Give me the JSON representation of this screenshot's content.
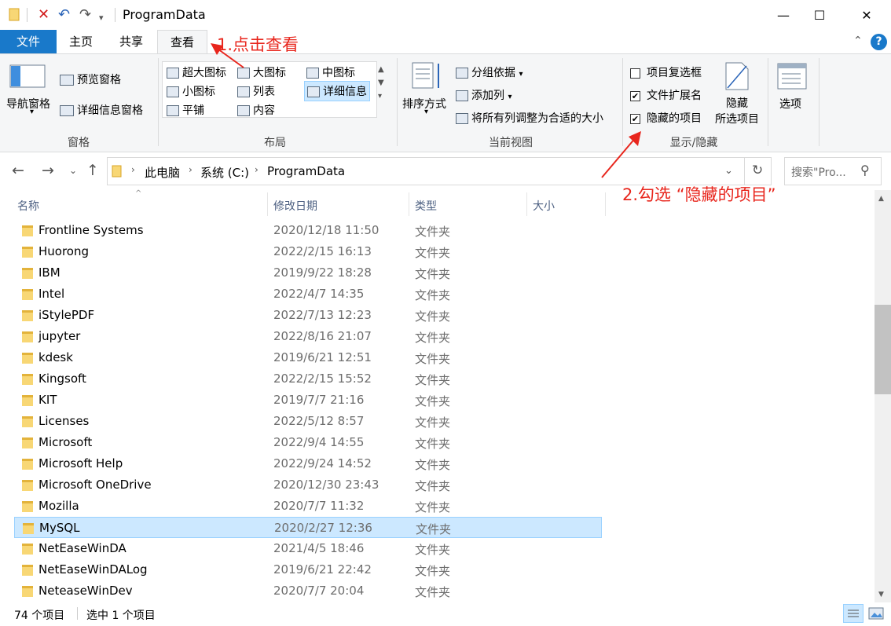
{
  "window": {
    "title": "ProgramData",
    "minimize_glyph": "—",
    "maximize_glyph": "☐",
    "close_glyph": "✕"
  },
  "tabs": {
    "file": "文件",
    "home": "主页",
    "share": "共享",
    "view": "查看"
  },
  "ribbon": {
    "pane_group": {
      "label": "窗格",
      "nav_pane": "导航窗格",
      "preview_pane": "预览窗格",
      "details_pane": "详细信息窗格"
    },
    "layout_group": {
      "label": "布局",
      "items": [
        "超大图标",
        "大图标",
        "中图标",
        "小图标",
        "列表",
        "详细信息",
        "平铺",
        "内容"
      ]
    },
    "current_view_group": {
      "label": "当前视图",
      "sort_by": "排序方式",
      "group_by": "分组依据",
      "add_columns": "添加列",
      "fit_columns": "将所有列调整为合适的大小"
    },
    "show_hide_group": {
      "label": "显示/隐藏",
      "item_checkboxes": {
        "label": "项目复选框",
        "checked": false
      },
      "file_extensions": {
        "label": "文件扩展名",
        "checked": true
      },
      "hidden_items": {
        "label": "隐藏的项目",
        "checked": true
      },
      "hide_selected_1": "隐藏",
      "hide_selected_2": "所选项目"
    },
    "options": "选项"
  },
  "address": {
    "crumbs": [
      "此电脑",
      "系统 (C:)",
      "ProgramData"
    ],
    "search_placeholder": "搜索\"Pro..."
  },
  "columns": {
    "name": "名称",
    "date": "修改日期",
    "type": "类型",
    "size": "大小"
  },
  "rows": [
    {
      "name": "Frontline Systems",
      "date": "2020/12/18 11:50",
      "type": "文件夹"
    },
    {
      "name": "Huorong",
      "date": "2022/2/15 16:13",
      "type": "文件夹"
    },
    {
      "name": "IBM",
      "date": "2019/9/22 18:28",
      "type": "文件夹"
    },
    {
      "name": "Intel",
      "date": "2022/4/7 14:35",
      "type": "文件夹"
    },
    {
      "name": "iStylePDF",
      "date": "2022/7/13 12:23",
      "type": "文件夹"
    },
    {
      "name": "jupyter",
      "date": "2022/8/16 21:07",
      "type": "文件夹"
    },
    {
      "name": "kdesk",
      "date": "2019/6/21 12:51",
      "type": "文件夹"
    },
    {
      "name": "Kingsoft",
      "date": "2022/2/15 15:52",
      "type": "文件夹"
    },
    {
      "name": "KIT",
      "date": "2019/7/7 21:16",
      "type": "文件夹"
    },
    {
      "name": "Licenses",
      "date": "2022/5/12 8:57",
      "type": "文件夹"
    },
    {
      "name": "Microsoft",
      "date": "2022/9/4 14:55",
      "type": "文件夹"
    },
    {
      "name": "Microsoft Help",
      "date": "2022/9/24 14:52",
      "type": "文件夹"
    },
    {
      "name": "Microsoft OneDrive",
      "date": "2020/12/30 23:43",
      "type": "文件夹"
    },
    {
      "name": "Mozilla",
      "date": "2020/7/7 11:32",
      "type": "文件夹"
    },
    {
      "name": "MySQL",
      "date": "2020/2/27 12:36",
      "type": "文件夹",
      "selected": true
    },
    {
      "name": "NetEaseWinDA",
      "date": "2021/4/5 18:46",
      "type": "文件夹"
    },
    {
      "name": "NetEaseWinDALog",
      "date": "2019/6/21 22:42",
      "type": "文件夹"
    },
    {
      "name": "NeteaseWinDev",
      "date": "2020/7/7 20:04",
      "type": "文件夹"
    }
  ],
  "status": {
    "count": "74 个项目",
    "selected": "选中 1 个项目"
  },
  "annotations": {
    "step1": "1.点击查看",
    "step2": "2.勾选 “隐藏的项目”"
  },
  "colors": {
    "accent": "#1979ca",
    "annotation": "#e8261d",
    "selection": "#cce8ff"
  }
}
